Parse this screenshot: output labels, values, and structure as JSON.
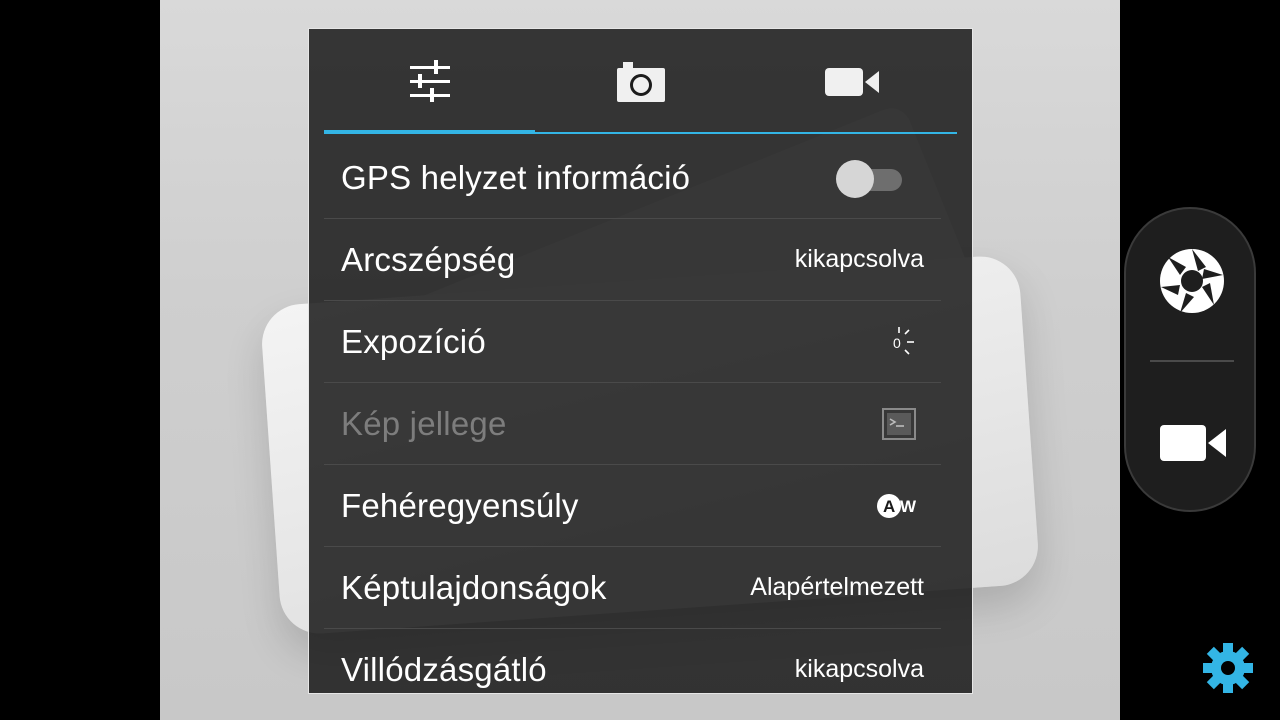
{
  "tabs": [
    {
      "name": "general-settings",
      "icon": "sliders-icon",
      "active": true
    },
    {
      "name": "photo-settings",
      "icon": "camera-icon",
      "active": false
    },
    {
      "name": "video-settings",
      "icon": "video-camera-icon",
      "active": false
    }
  ],
  "rows": {
    "gps": {
      "label": "GPS helyzet információ",
      "enabled": false
    },
    "face_beauty": {
      "label": "Arcszépség",
      "value": "kikapcsolva"
    },
    "exposure": {
      "label": "Expozíció",
      "value": "0",
      "icon": "exposure-icon"
    },
    "scene_mode": {
      "label": "Kép jellege",
      "icon": "scene-mode-icon",
      "disabled": true
    },
    "white_balance": {
      "label": "Fehéregyensúly",
      "icon": "auto-white-balance-icon",
      "icon_text": "A",
      "icon_text_suffix": "W"
    },
    "image_properties": {
      "label": "Képtulajdonságok",
      "value": "Alapértelmezett"
    },
    "anti_flicker": {
      "label": "Villódzásgátló",
      "value": "kikapcsolva"
    }
  },
  "controls": {
    "shutter_icon": "shutter-icon",
    "video_icon": "video-camera-icon",
    "settings_icon": "gear-icon"
  },
  "colors": {
    "accent": "#33b5e5",
    "panel_bg": "#1a1a1a",
    "text": "#ffffff",
    "disabled_text": "#7d7d7d"
  }
}
